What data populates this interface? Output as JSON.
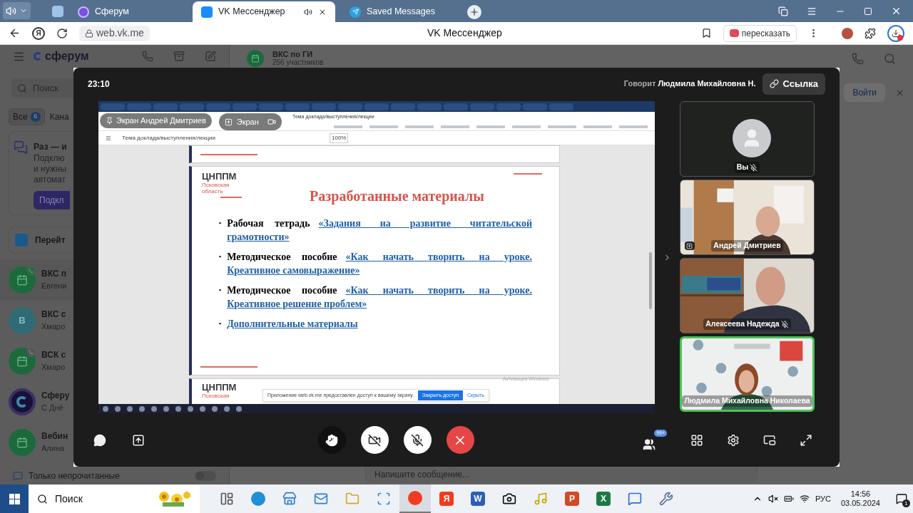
{
  "browser": {
    "tabs": [
      {
        "title": "Сферум",
        "kind": "sferum",
        "selected": false,
        "audio": false
      },
      {
        "title": "VK Мессенджер",
        "kind": "vk",
        "selected": true,
        "audio": true
      },
      {
        "title": "Saved Messages",
        "kind": "telegram",
        "selected": false,
        "audio": false
      }
    ],
    "logo_glyph": "Я",
    "url": "web.vk.me",
    "page_title": "VK Мессенджер",
    "summarize": "пересказать"
  },
  "app": {
    "brand": "сферум",
    "search": {
      "placeholder": "Поиск"
    },
    "filters": [
      {
        "label": "Все",
        "count": "6",
        "selected": true
      },
      {
        "label": "Кана",
        "selected": false
      }
    ],
    "promo": {
      "title": "Раз — и",
      "text": "Подклю\nи нужны\nавтомат",
      "button": "Подкл"
    },
    "goto": "Перейт",
    "chats": [
      {
        "title": "ВКС п",
        "preview": "Евгени",
        "kind": "live"
      },
      {
        "title": "ВКС с",
        "preview": "Хмаро",
        "kind": "letter",
        "letter": "В"
      },
      {
        "title": "ВСК с",
        "preview": "Хмаро",
        "kind": "past"
      },
      {
        "title": "Сферу",
        "preview": "С Днё",
        "kind": "channel"
      },
      {
        "title": "Вебин",
        "preview": "Алина",
        "kind": "event"
      }
    ],
    "unread_only": {
      "label": "Только непрочитанные",
      "on": false
    },
    "chat_header": {
      "title": "ВКС по ГИ",
      "subtitle": "256 участников"
    },
    "login": "Войти",
    "composer": {
      "placeholder": "Напишите сообщение..."
    }
  },
  "call": {
    "timer": "23:10",
    "speaker_prefix": "Говорит",
    "speaker": "Людмила Михайловна Н.",
    "link_button": "Ссылка",
    "screen": {
      "presenter_pill": "Экран Андрей Дмитриев",
      "screen_pill": "Экран",
      "doc_title": "Тема доклада/выступления/лекции",
      "pdf_title": "Тема доклада/выступления/лекции",
      "zoom": "100%",
      "slide": {
        "logo": "ЦНППМ",
        "region": "Псковская область",
        "title": "Разработанные материалы",
        "items": [
          {
            "bullet": "•",
            "lead": "Рабочая тетрадь",
            "link": [
              "«Задания на развитие читательской",
              "грамотности»"
            ]
          },
          {
            "bullet": "•",
            "lead": "Методическое пособие",
            "link": [
              "«Как начать творить на уроке.",
              "Креативное самовыражение»"
            ]
          },
          {
            "bullet": "•",
            "lead": "Методическое пособие",
            "link": [
              "«Как начать творить на уроке.",
              "Креативное решение проблем»"
            ]
          },
          {
            "bullet": "•",
            "link": [
              "Дополнительные материалы"
            ]
          }
        ]
      },
      "next_slide": {
        "logo": "ЦНППМ",
        "region": "Псковская"
      },
      "notice": {
        "text": "Приложение web.vk.me предоставлен доступ к вашему экрану.",
        "stop": "Закрыть доступ",
        "hide": "Скрыть"
      },
      "activation": "Активация Windows"
    },
    "participants": [
      {
        "name": "Вы",
        "kind": "avatar",
        "mic_off": true,
        "sharing": false,
        "speaking": false
      },
      {
        "name": "Андрей Дмитриев",
        "kind": "video",
        "mic_off": false,
        "sharing": true,
        "speaking": false
      },
      {
        "name": "Алексеева Надежда",
        "kind": "video",
        "mic_off": true,
        "sharing": false,
        "speaking": false
      },
      {
        "name": "Людмила Михайловна Николаева",
        "kind": "video",
        "mic_off": false,
        "sharing": false,
        "speaking": true
      }
    ],
    "camera_on": false,
    "mic_on": false,
    "participants_badge": "99+"
  },
  "taskbar": {
    "search": {
      "placeholder": "Поиск"
    },
    "apps": [
      {
        "kind": "taskview",
        "active": false
      },
      {
        "kind": "edge",
        "active": false
      },
      {
        "kind": "store",
        "active": false
      },
      {
        "kind": "mail",
        "active": false
      },
      {
        "kind": "folder",
        "active": false
      },
      {
        "kind": "scanner",
        "active": false
      },
      {
        "kind": "ybrowser",
        "active": true
      },
      {
        "kind": "letter",
        "glyph": "Я",
        "active": false
      },
      {
        "kind": "letter",
        "glyph": "W",
        "active": false
      },
      {
        "kind": "camera",
        "active": false
      },
      {
        "kind": "music",
        "active": false
      },
      {
        "kind": "letter",
        "glyph": "P",
        "active": false
      },
      {
        "kind": "letter",
        "glyph": "X",
        "active": false
      },
      {
        "kind": "vk",
        "active": false
      },
      {
        "kind": "tool",
        "active": false
      }
    ],
    "lang": "РУС",
    "time": "14:56",
    "date": "03.05.2024",
    "notifications": "1"
  }
}
